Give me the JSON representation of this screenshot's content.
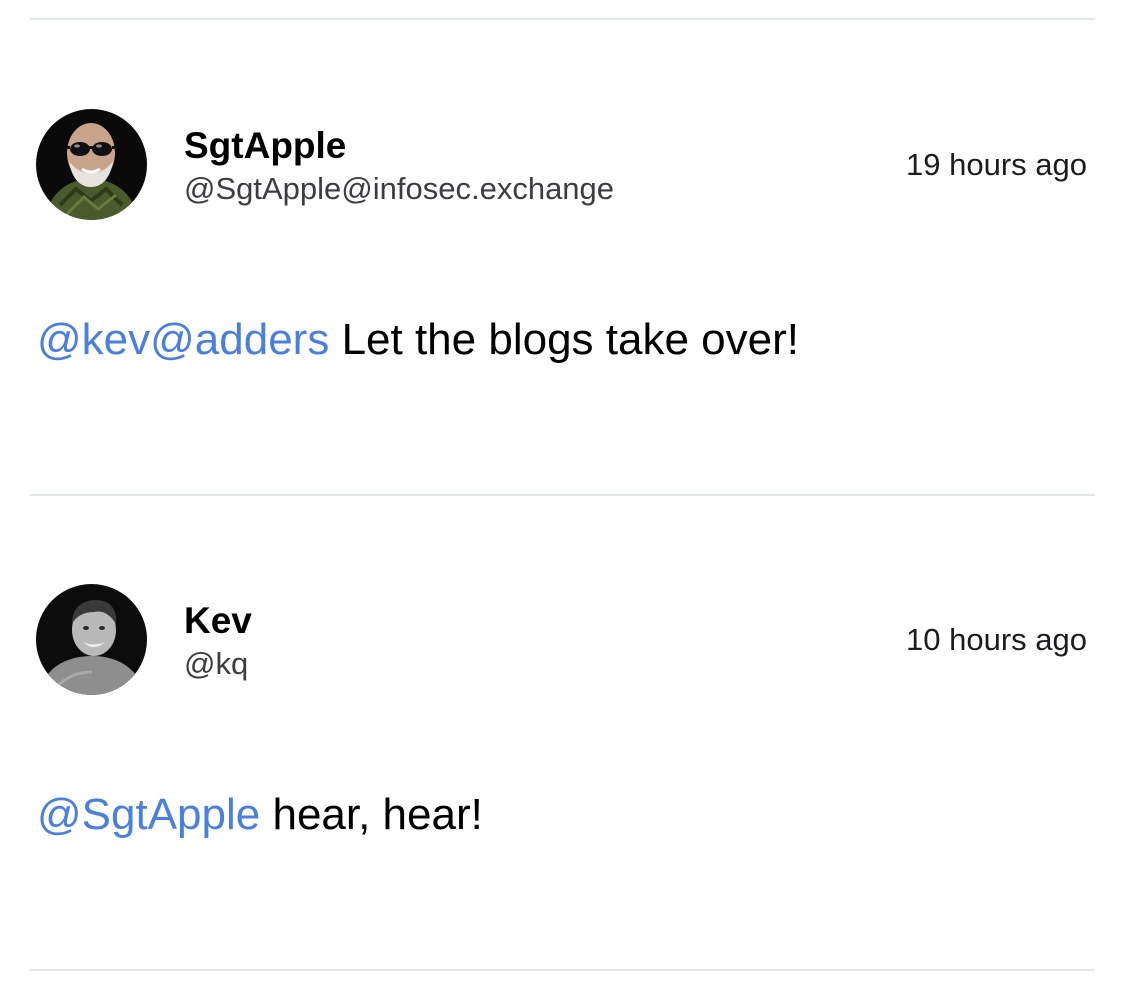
{
  "posts": [
    {
      "author": {
        "display_name": "SgtApple",
        "handle": "@SgtApple@infosec.exchange",
        "avatar_icon": "avatar-photo-man-sunglasses"
      },
      "timestamp": "19 hours ago",
      "mention": "@kev@adders",
      "text": " Let the blogs take over!"
    },
    {
      "author": {
        "display_name": "Kev",
        "handle": "@kq",
        "avatar_icon": "avatar-photo-man-smiling"
      },
      "timestamp": "10 hours ago",
      "mention": "@SgtApple",
      "text": " hear, hear!"
    }
  ],
  "colors": {
    "mention": "#4a7fe0",
    "divider": "#e3e6ea",
    "handle": "#3c3c43"
  }
}
